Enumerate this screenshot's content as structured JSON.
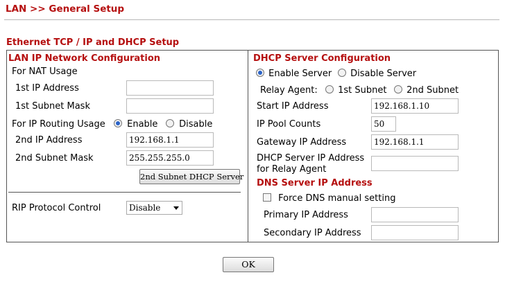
{
  "header": {
    "page_title": "LAN >> General Setup",
    "section_title": "Ethernet TCP / IP and DHCP Setup"
  },
  "lan": {
    "heading": "LAN IP Network Configuration",
    "for_nat_label": "For NAT Usage",
    "ip1_label": "1st IP Address",
    "ip1_value": "",
    "mask1_label": "1st Subnet Mask",
    "mask1_value": "",
    "routing_label": "For IP Routing Usage",
    "routing_enable_label": "Enable",
    "routing_disable_label": "Disable",
    "routing_selected": "Enable",
    "ip2_label": "2nd IP Address",
    "ip2_value": "192.168.1.1",
    "mask2_label": "2nd Subnet Mask",
    "mask2_value": "255.255.255.0",
    "dhcp2_button": "2nd Subnet DHCP Server",
    "rip_label": "RIP Protocol Control",
    "rip_value": "Disable"
  },
  "dhcp": {
    "heading": "DHCP Server Configuration",
    "enable_label": "Enable Server",
    "disable_label": "Disable Server",
    "server_selected": "Enable Server",
    "relay_label": "Relay Agent:",
    "relay_1st": "1st Subnet",
    "relay_2nd": "2nd Subnet",
    "start_ip_label": "Start IP Address",
    "start_ip_value": "192.168.1.10",
    "pool_label": "IP Pool Counts",
    "pool_value": "50",
    "gateway_label": "Gateway IP Address",
    "gateway_value": "192.168.1.1",
    "relay_ip_label_line1": "DHCP Server IP Address",
    "relay_ip_label_line2": "for Relay Agent",
    "relay_ip_value": ""
  },
  "dns": {
    "heading": "DNS Server IP Address",
    "force_label": "Force DNS manual setting",
    "force_checked": false,
    "primary_label": "Primary IP Address",
    "primary_value": "",
    "secondary_label": "Secondary IP Address",
    "secondary_value": ""
  },
  "footer": {
    "ok_label": "OK"
  }
}
